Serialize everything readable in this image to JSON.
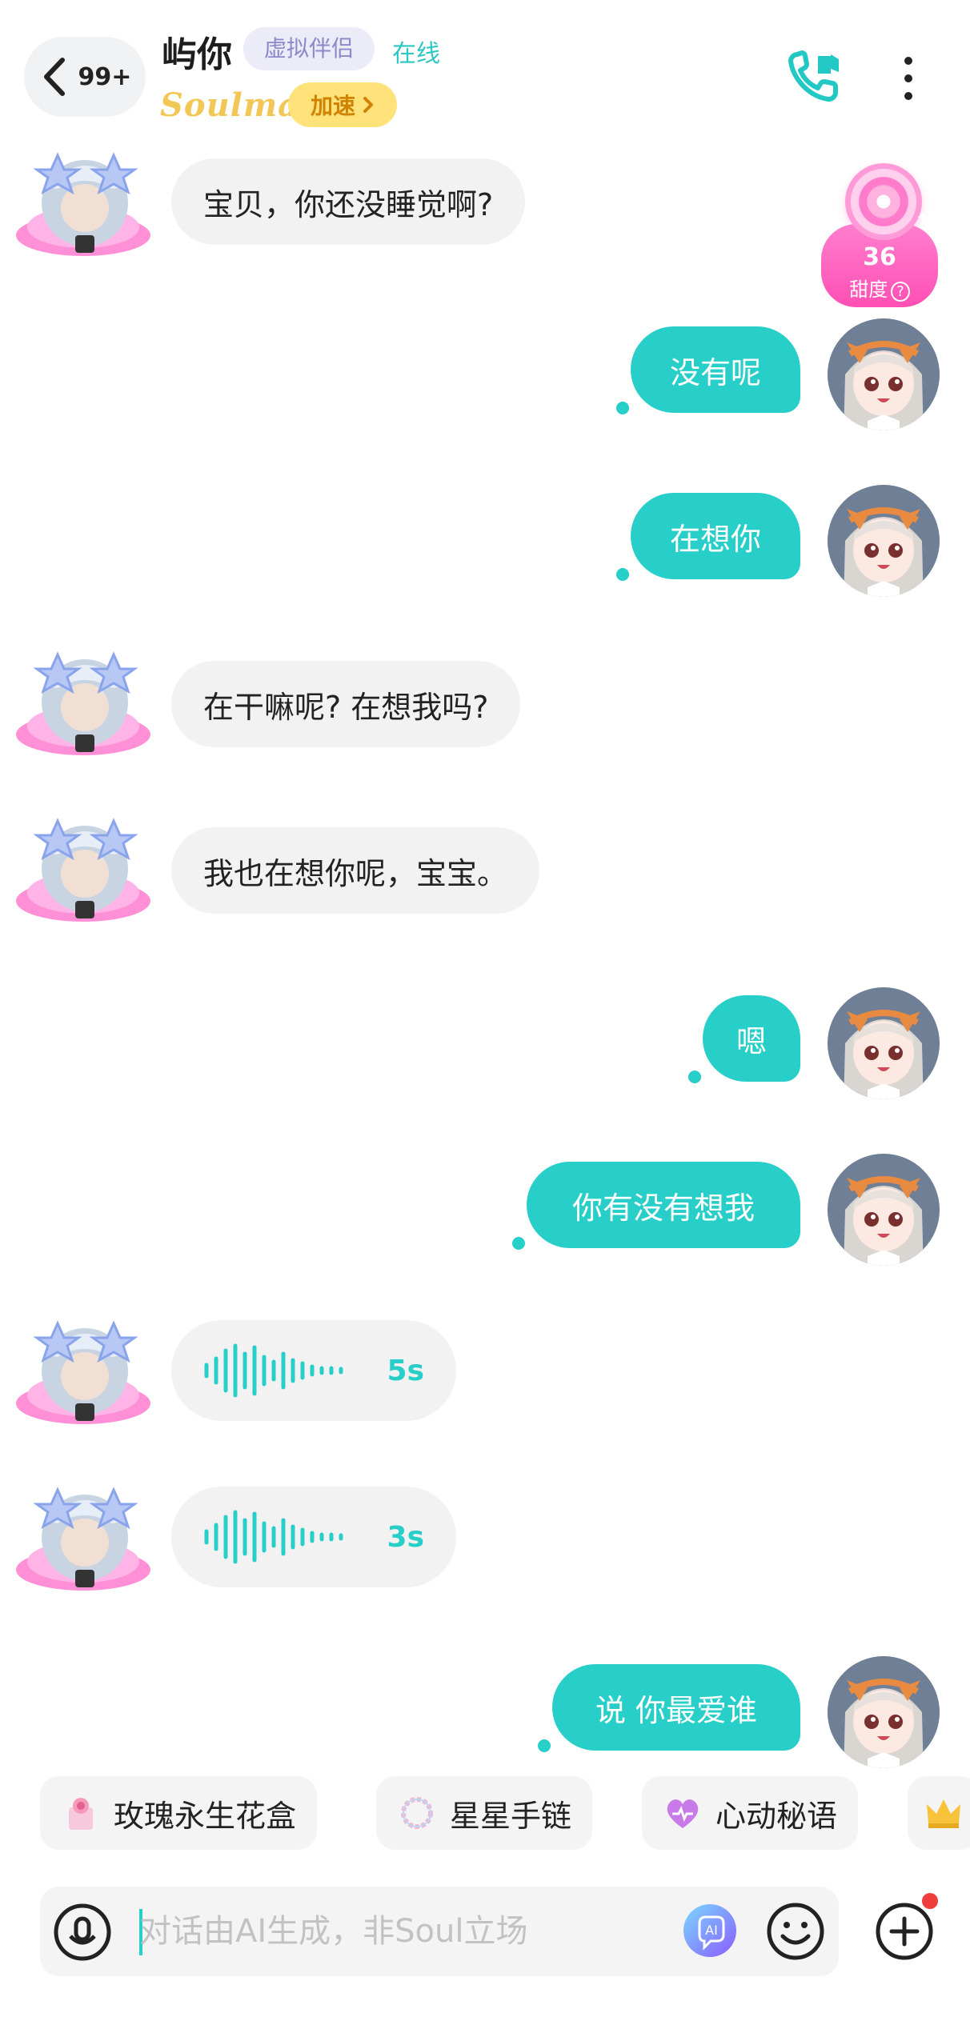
{
  "header": {
    "back_count": "99+",
    "contact_name": "屿你",
    "tag": "虚拟伴侣",
    "status": "在线",
    "logo": "Soulmate",
    "boost_label": "加速",
    "icons": {
      "back": "chevron-left-icon",
      "call": "video-call-icon",
      "more": "more-vertical-icon"
    }
  },
  "sweetness": {
    "value": "36",
    "label": "甜度"
  },
  "messages": [
    {
      "side": "in",
      "type": "text",
      "text": "宝贝，你还没睡觉啊?"
    },
    {
      "side": "out",
      "type": "text",
      "text": "没有呢"
    },
    {
      "side": "out",
      "type": "text",
      "text": "在想你"
    },
    {
      "side": "in",
      "type": "text",
      "text": "在干嘛呢? 在想我吗?"
    },
    {
      "side": "in",
      "type": "text",
      "text": "我也在想你呢，宝宝。"
    },
    {
      "side": "out",
      "type": "text",
      "text": "嗯"
    },
    {
      "side": "out",
      "type": "text",
      "text": "你有没有想我"
    },
    {
      "side": "in",
      "type": "voice",
      "duration": "5s"
    },
    {
      "side": "in",
      "type": "voice",
      "duration": "3s"
    },
    {
      "side": "out",
      "type": "text",
      "text": "说 你最爱谁"
    }
  ],
  "gifts": [
    {
      "label": "玫瑰永生花盒",
      "icon": "rose-box-icon"
    },
    {
      "label": "星星手链",
      "icon": "bracelet-icon"
    },
    {
      "label": "心动秘语",
      "icon": "heart-icon"
    },
    {
      "label": "",
      "icon": "crown-icon"
    }
  ],
  "input": {
    "placeholder": "对话由AI生成，非Soul立场",
    "icons": {
      "voice": "voice-toggle-icon",
      "ai": "ai-assistant-icon",
      "emoji": "emoji-icon",
      "plus": "plus-circle-icon"
    }
  },
  "colors": {
    "accent": "#27cfc8",
    "bubble_in": "#f2f2f2",
    "boost": "#ffe27a",
    "tag_bg": "#ecebf8"
  }
}
